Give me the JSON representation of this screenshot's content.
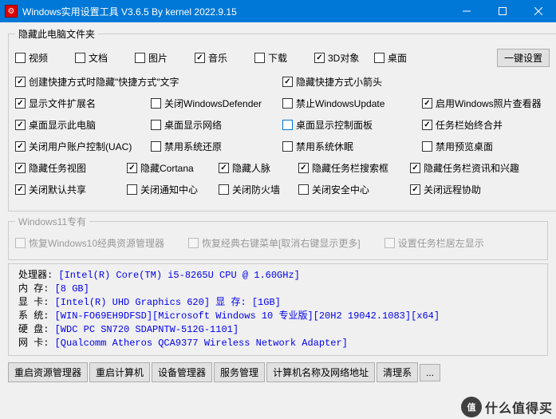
{
  "window": {
    "title": "Windows实用设置工具 V3.6.5 By kernel 2022.9.15"
  },
  "group1": {
    "legend": "隐藏此电脑文件夹",
    "items": [
      {
        "label": "视频",
        "checked": false
      },
      {
        "label": "文档",
        "checked": false
      },
      {
        "label": "图片",
        "checked": false
      },
      {
        "label": "音乐",
        "checked": true
      },
      {
        "label": "下载",
        "checked": false
      },
      {
        "label": "3D对象",
        "checked": true
      },
      {
        "label": "桌面",
        "checked": false
      }
    ],
    "btn": "一键设置",
    "rows": [
      [
        {
          "label": "创建快捷方式时隐藏\"快捷方式\"文字",
          "checked": true,
          "span": 2
        },
        {
          "label": "隐藏快捷方式小箭头",
          "checked": true,
          "span": 2
        }
      ],
      [
        {
          "label": "显示文件扩展名",
          "checked": true
        },
        {
          "label": "关闭WindowsDefender",
          "checked": false
        },
        {
          "label": "禁止WindowsUpdate",
          "checked": false
        },
        {
          "label": "启用Windows照片查看器",
          "checked": true
        }
      ],
      [
        {
          "label": "桌面显示此电脑",
          "checked": true
        },
        {
          "label": "桌面显示网络",
          "checked": false
        },
        {
          "label": "桌面显示控制面板",
          "checked": false,
          "blue": true
        },
        {
          "label": "任务栏始终合并",
          "checked": true
        }
      ],
      [
        {
          "label": "关闭用户账户控制(UAC)",
          "checked": true
        },
        {
          "label": "禁用系统还原",
          "checked": false
        },
        {
          "label": "禁用系统休眠",
          "checked": false
        },
        {
          "label": "禁用预览桌面",
          "checked": false
        }
      ],
      [
        {
          "label": "隐藏任务视图",
          "checked": true
        },
        {
          "label": "隐藏Cortana",
          "checked": true
        },
        {
          "label": "隐藏人脉",
          "checked": true
        },
        {
          "label": "隐藏任务栏搜索框",
          "checked": true
        },
        {
          "label": "隐藏任务栏资讯和兴趣",
          "checked": true
        }
      ],
      [
        {
          "label": "关闭默认共享",
          "checked": true
        },
        {
          "label": "关闭通知中心",
          "checked": false
        },
        {
          "label": "关闭防火墙",
          "checked": false
        },
        {
          "label": "关闭安全中心",
          "checked": false
        },
        {
          "label": "关闭远程协助",
          "checked": true
        }
      ]
    ]
  },
  "group2": {
    "legend": "Windows11专有",
    "items": [
      {
        "label": "恢复Windows10经典资源管理器"
      },
      {
        "label": "恢复经典右键菜单[取消右键显示更多]"
      },
      {
        "label": "设置任务栏居左显示"
      }
    ]
  },
  "sysinfo": {
    "lines": [
      {
        "lbl": "处理器:",
        "val": "[Intel(R) Core(TM) i5-8265U CPU @ 1.60GHz]"
      },
      {
        "lbl": "内  存:",
        "val": "[8 GB]"
      },
      {
        "lbl": "显  卡:",
        "val": "[Intel(R) UHD Graphics 620]  显  存: [1GB]"
      },
      {
        "lbl": "系  统:",
        "val": "[WIN-FO69EH9DFSD][Microsoft Windows 10 专业版][20H2 19042.1083][x64]"
      },
      {
        "lbl": "硬  盘:",
        "val": "[WDC PC SN720 SDAPNTW-512G-1101]"
      },
      {
        "lbl": "网  卡:",
        "val": "[Qualcomm Atheros QCA9377 Wireless Network Adapter]"
      }
    ]
  },
  "footer": {
    "buttons": [
      "重启资源管理器",
      "重启计算机",
      "设备管理器",
      "服务管理",
      "计算机名称及网络地址",
      "清理系",
      "..."
    ]
  },
  "watermark": {
    "circle": "值",
    "text": "什么值得买"
  }
}
